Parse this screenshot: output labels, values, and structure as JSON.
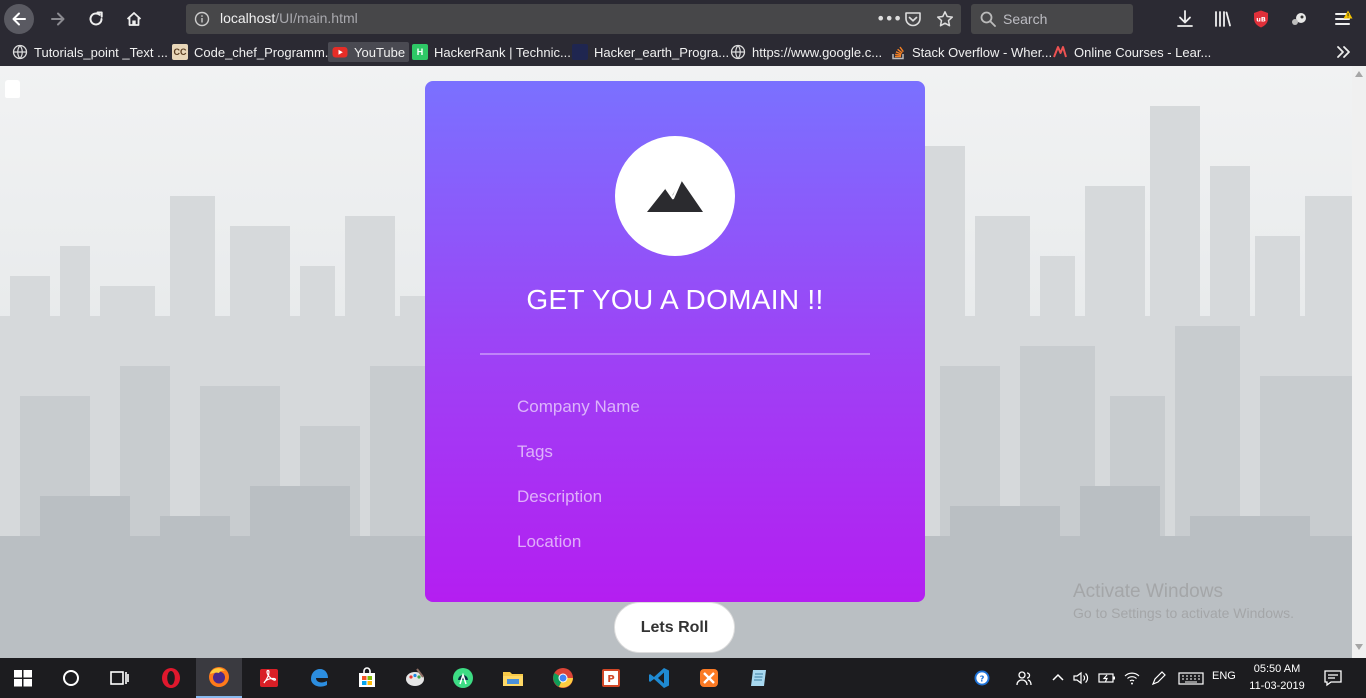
{
  "browser": {
    "url_host": "localhost",
    "url_path": "/UI/main.html",
    "search_placeholder": "Search",
    "url_dots": "•••"
  },
  "bookmarks": [
    {
      "label": "Tutorials_point _Text ...",
      "icon": "globe-icon"
    },
    {
      "label": "Code_chef_Programm...",
      "icon": "codechef-icon"
    },
    {
      "label": "YouTube",
      "icon": "youtube-icon"
    },
    {
      "label": "HackerRank | Technic...",
      "icon": "hackerrank-icon"
    },
    {
      "label": "Hacker_earth_Progra...",
      "icon": "hackerearth-icon"
    },
    {
      "label": "https://www.google.c...",
      "icon": "globe-icon"
    },
    {
      "label": "Stack Overflow - Wher...",
      "icon": "stackoverflow-icon"
    },
    {
      "label": "Online Courses - Lear...",
      "icon": "udemy-icon"
    }
  ],
  "card": {
    "title": "GET YOU A DOMAIN !!",
    "fields": [
      {
        "placeholder": "Company Name"
      },
      {
        "placeholder": "Tags"
      },
      {
        "placeholder": "Description"
      },
      {
        "placeholder": "Location"
      }
    ],
    "button_label": "Lets Roll"
  },
  "watermark": {
    "title": "Activate Windows",
    "subtitle": "Go to Settings to activate Windows."
  },
  "taskbar": {
    "language": "ENG",
    "time": "05:50 AM",
    "date": "11-03-2019"
  },
  "colors": {
    "card_top": "#7a71ff",
    "card_bottom": "#b41ef1",
    "chrome_bg": "#2b2a33",
    "taskbar_bg": "#1c1c1f"
  }
}
